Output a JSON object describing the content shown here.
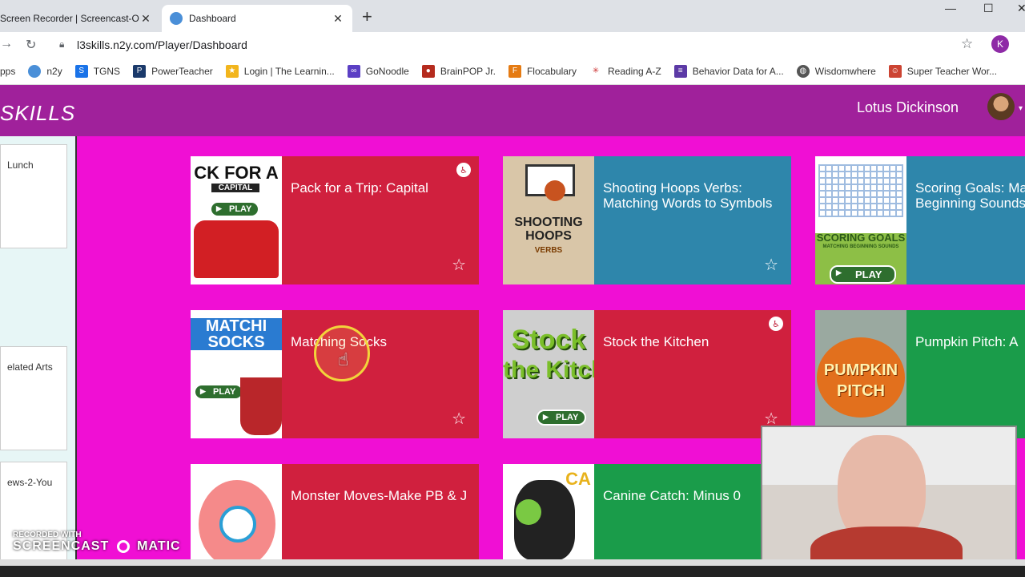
{
  "browser": {
    "tabs": [
      {
        "title": "Screen Recorder | Screencast-O-M"
      },
      {
        "title": "Dashboard"
      }
    ],
    "url": "l3skills.n2y.com/Player/Dashboard",
    "profile_initial": "K",
    "bookmarks": [
      {
        "label": "pps",
        "icon": "apps-icon"
      },
      {
        "label": "n2y",
        "icon": "n2y-icon"
      },
      {
        "label": "TGNS",
        "icon": "s-icon"
      },
      {
        "label": "PowerTeacher",
        "icon": "p-icon"
      },
      {
        "label": "Login | The Learnin...",
        "icon": "star-person-icon"
      },
      {
        "label": "GoNoodle",
        "icon": "gonoodle-icon"
      },
      {
        "label": "BrainPOP Jr.",
        "icon": "brainpop-icon"
      },
      {
        "label": "Flocabulary",
        "icon": "f-icon"
      },
      {
        "label": "Reading A-Z",
        "icon": "raz-icon"
      },
      {
        "label": "Behavior Data for A...",
        "icon": "list-icon"
      },
      {
        "label": "Wisdomwhere",
        "icon": "globe-icon"
      },
      {
        "label": "Super Teacher Wor...",
        "icon": "stw-icon"
      }
    ]
  },
  "app": {
    "brand": "SKILLS",
    "user_name": "Lotus Dickinson"
  },
  "sidebar": {
    "cards": [
      "Lunch",
      "elated Arts",
      "ews-2-You"
    ]
  },
  "tiles": [
    {
      "title": "Pack for a Trip: Capital",
      "color": "#d0203e",
      "thumb_text": "CK FOR A",
      "thumb_sub": "CAPITAL",
      "play": "PLAY"
    },
    {
      "title": "Shooting Hoops Verbs: Matching Words to Symbols",
      "color": "#2e86ab",
      "thumb_text": "SHOOTING HOOPS",
      "thumb_sub": "VERBS"
    },
    {
      "title": "Scoring Goals: Matching Beginning Sounds",
      "color": "#2e86ab",
      "thumb_text": "SCORING GOALS",
      "thumb_sub": "MATCHING BEGINNING SOUNDS",
      "play": "PLAY"
    },
    {
      "title": "Matching Socks",
      "color": "#d0203e",
      "thumb_text": "MATCHI",
      "thumb_sub": "SOCKS",
      "play": "PLAY"
    },
    {
      "title": "Stock the Kitchen",
      "color": "#d0203e",
      "thumb_text": "Stock",
      "thumb_sub": "the Kitch",
      "play": "PLAY"
    },
    {
      "title": "Pumpkin Pitch: A",
      "color": "#1a9c4a",
      "thumb_text": "PUMPKIN",
      "thumb_sub": "PITCH"
    },
    {
      "title": "Monster Moves-Make PB & J",
      "color": "#d0203e"
    },
    {
      "title": "Canine Catch: Minus 0",
      "color": "#1a9c4a",
      "thumb_text": "CA"
    }
  ],
  "watermark": {
    "line1": "RECORDED WITH",
    "line2": "SCREENCAST",
    "line3": "MATIC"
  }
}
